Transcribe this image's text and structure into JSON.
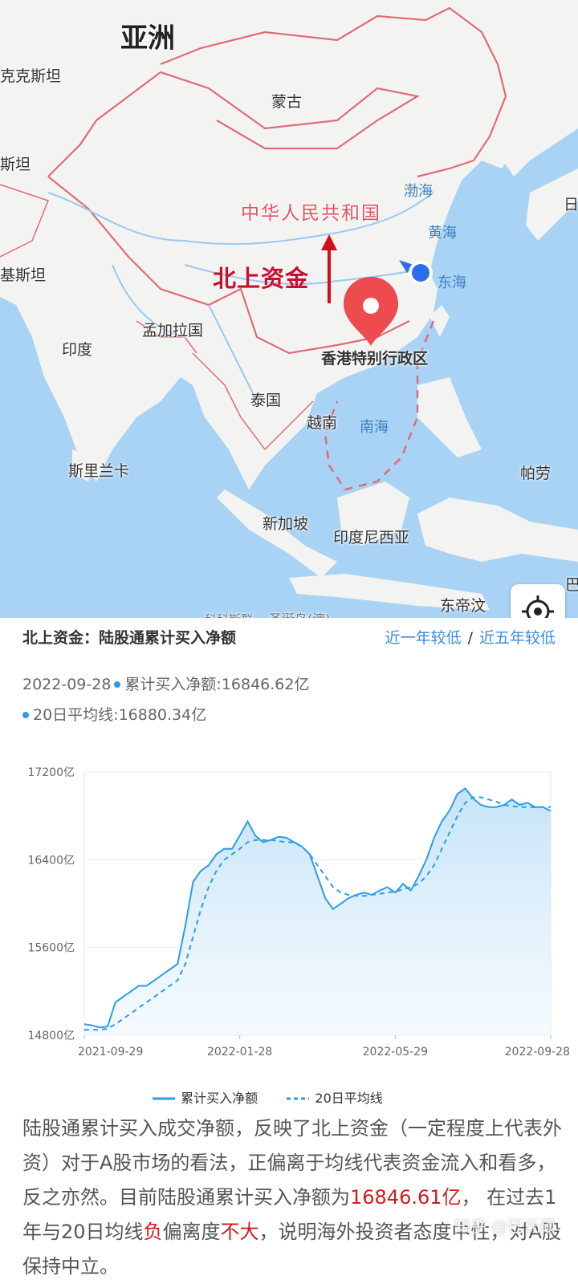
{
  "map": {
    "labels": {
      "asia": "亚洲",
      "kazakh": "克克斯坦",
      "mongolia": "蒙古",
      "tan": "斯坦",
      "bohai": "渤海",
      "ri": "日",
      "yellow_sea": "黄海",
      "east_sea": "东海",
      "kistan": "基斯坦",
      "bangladesh": "孟加拉国",
      "india": "印度",
      "hk": "香港特别行政区",
      "thailand": "泰国",
      "vietnam": "越南",
      "south_sea": "南海",
      "sri_lanka": "斯里兰卡",
      "palau": "帕劳",
      "singapore": "新加坡",
      "indonesia": "印度尼西亚",
      "ba": "巴",
      "timor": "东帝汶",
      "cocos": "科科斯群",
      "christmas": "圣诞岛(澳)"
    },
    "country_label": "中华人民共和国",
    "annotation": "北上资金",
    "locate_icon": "crosshair-icon"
  },
  "panel": {
    "title": "北上资金：陆股通累计买入净额",
    "link_year": "近一年较低",
    "link_sep": "/",
    "link_five": "近五年较低"
  },
  "info": {
    "date": "2022-09-28",
    "cum_label": "累计买入净额:16846.62亿",
    "ma_label": "20日平均线:16880.34亿"
  },
  "colors": {
    "line": "#2a9ee6",
    "fill": "#cfe7fa",
    "accent_red": "#d01c1c",
    "link": "#3a8be0"
  },
  "chart_data": {
    "type": "line",
    "title": "",
    "y_ticks": [
      "17200亿",
      "16400亿",
      "15600亿",
      "14800亿"
    ],
    "ylim": [
      14800,
      17200
    ],
    "x_ticks": [
      "2021-09-29",
      "2022-01-28",
      "2022-05-29",
      "2022-09-28"
    ],
    "series": [
      {
        "name": "累计买入净额",
        "style": "solid",
        "values": [
          14900,
          14890,
          14870,
          14880,
          15100,
          15150,
          15200,
          15250,
          15250,
          15300,
          15350,
          15400,
          15450,
          15800,
          16200,
          16300,
          16350,
          16450,
          16500,
          16500,
          16620,
          16750,
          16620,
          16560,
          16580,
          16610,
          16600,
          16560,
          16520,
          16450,
          16250,
          16050,
          15950,
          16000,
          16050,
          16080,
          16100,
          16080,
          16120,
          16150,
          16100,
          16180,
          16120,
          16250,
          16400,
          16600,
          16750,
          16850,
          17000,
          17050,
          16960,
          16900,
          16880,
          16880,
          16900,
          16950,
          16900,
          16920,
          16880,
          16880,
          16846
        ]
      },
      {
        "name": "20日平均线",
        "style": "dashed",
        "values": [
          14850,
          14850,
          14850,
          14860,
          14900,
          14950,
          15000,
          15050,
          15100,
          15150,
          15200,
          15250,
          15300,
          15450,
          15700,
          15950,
          16150,
          16300,
          16400,
          16450,
          16500,
          16560,
          16580,
          16580,
          16580,
          16570,
          16560,
          16560,
          16520,
          16450,
          16350,
          16250,
          16150,
          16100,
          16080,
          16070,
          16070,
          16080,
          16090,
          16100,
          16110,
          16130,
          16150,
          16180,
          16250,
          16350,
          16500,
          16650,
          16800,
          16920,
          16970,
          16970,
          16950,
          16930,
          16900,
          16890,
          16880,
          16880,
          16880,
          16880,
          16880
        ]
      }
    ]
  },
  "legend": {
    "s1": "累计买入净额",
    "s2": "20日平均线"
  },
  "desc": {
    "p1": "陆股通累计买入成交净额，反映了北上资金（一定程度上代表外资）对于A股市场的看法，正偏离于均线代表资金流入和看多，反之亦然。目前陆股通累计买入净额为",
    "v1": "16846.61亿",
    "p2": "，  在过去1年与20日均线",
    "neg": "负",
    "p3": "偏离度",
    "small": "不大",
    "p4": "，说明海外投资者态度中性，对A股保持中立。"
  },
  "watermark": "知乎 @巴氏硕"
}
